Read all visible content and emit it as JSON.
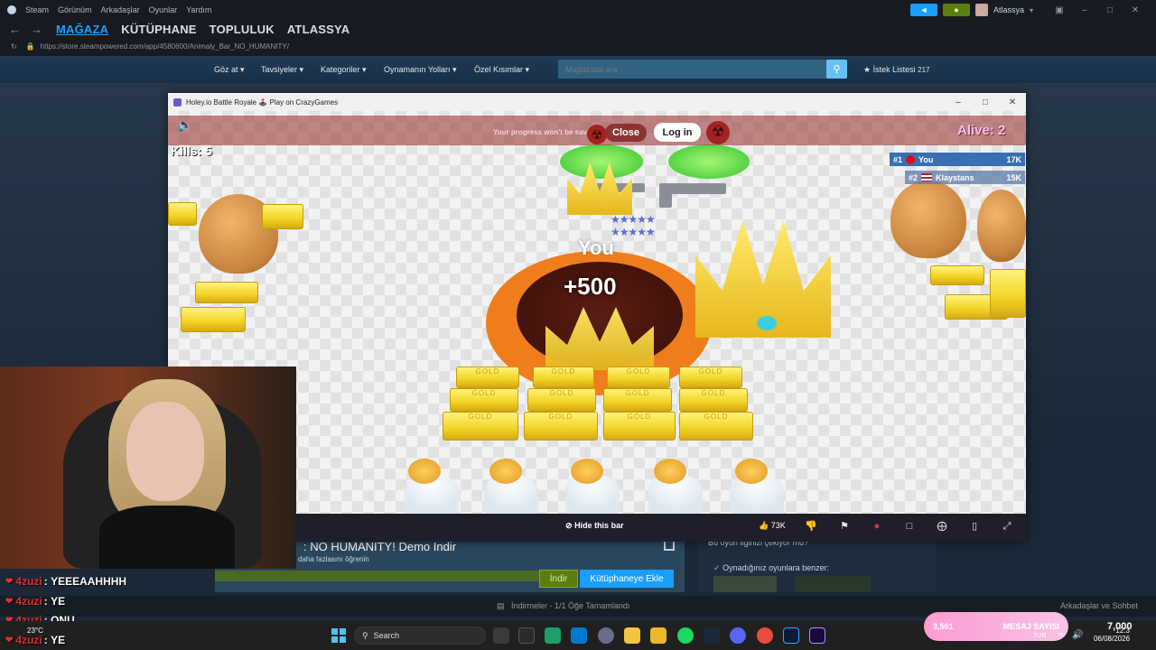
{
  "steam": {
    "menu": [
      "Steam",
      "Görünüm",
      "Arkadaşlar",
      "Oyunlar",
      "Yardım"
    ],
    "tabs": [
      "MAĞAZA",
      "KÜTÜPHANE",
      "TOPLULUK",
      "ATLASSYA"
    ],
    "url": "https://store.steampowered.com/app/4580600/Animaly_Bar_NO_HUMANITY/",
    "username": "Atlassya",
    "store_nav": [
      "Göz at",
      "Tavsiyeler",
      "Kategoriler",
      "Oynamanın Yolları",
      "Özel Kısımlar"
    ],
    "search_placeholder": "Mağazada ara",
    "wishlist_label": "İstek Listesi",
    "wishlist_count": "217"
  },
  "game_window": {
    "title": "Holey.io Battle Royale 🕹️ Play on CrazyGames",
    "progress_text": "Your progress won't be saved!",
    "close_label": "Close",
    "login_label": "Log in",
    "kills": "Kills: 5",
    "alive": "Alive: 2",
    "leaderboard": [
      {
        "rank": "#1",
        "name": "You",
        "score": "17K"
      },
      {
        "rank": "#2",
        "name": "Klaystans",
        "score": "15K"
      }
    ],
    "player_label": "You",
    "score_popup": "+500",
    "gold_text": "GOLD",
    "hide_bar_label": "Hide this bar",
    "likes": "73K"
  },
  "store_page": {
    "purchase_title": ": NO HUMANITY! Demo İndir",
    "purchase_sub": "daha fazlasını öğrenin",
    "install_label": "İndir",
    "add_library_label": "Kütüphaneye Ekle",
    "side_question": "Bu oyun ilginizi çekiyor mu?",
    "similar_label": "Oynadığınız oyunlara benzer:"
  },
  "downloads": {
    "text": "İndirmeler - 1/1 Öğe Tamamlandı",
    "friends": "Arkadaşlar ve Sohbet"
  },
  "chat": [
    {
      "user": "4zuzi",
      "message": "YEEEAAHHHH"
    },
    {
      "user": "4zuzi",
      "message": "YE"
    },
    {
      "user": "4zuzi",
      "message": "ONU"
    },
    {
      "user": "4zuzi",
      "message": "YE"
    }
  ],
  "taskbar": {
    "search_label": "Search",
    "weather": "23°C",
    "badge_count": "3,561",
    "badge_label": "MESAJ SAYISI",
    "badge_value": "7,000",
    "time": "12:3",
    "date": "06/08/2026",
    "lang": "TUR"
  },
  "colors": {
    "steam_blue": "#1a9fff",
    "hole_orange": "#f07d1c",
    "gold": "#f2d324"
  }
}
